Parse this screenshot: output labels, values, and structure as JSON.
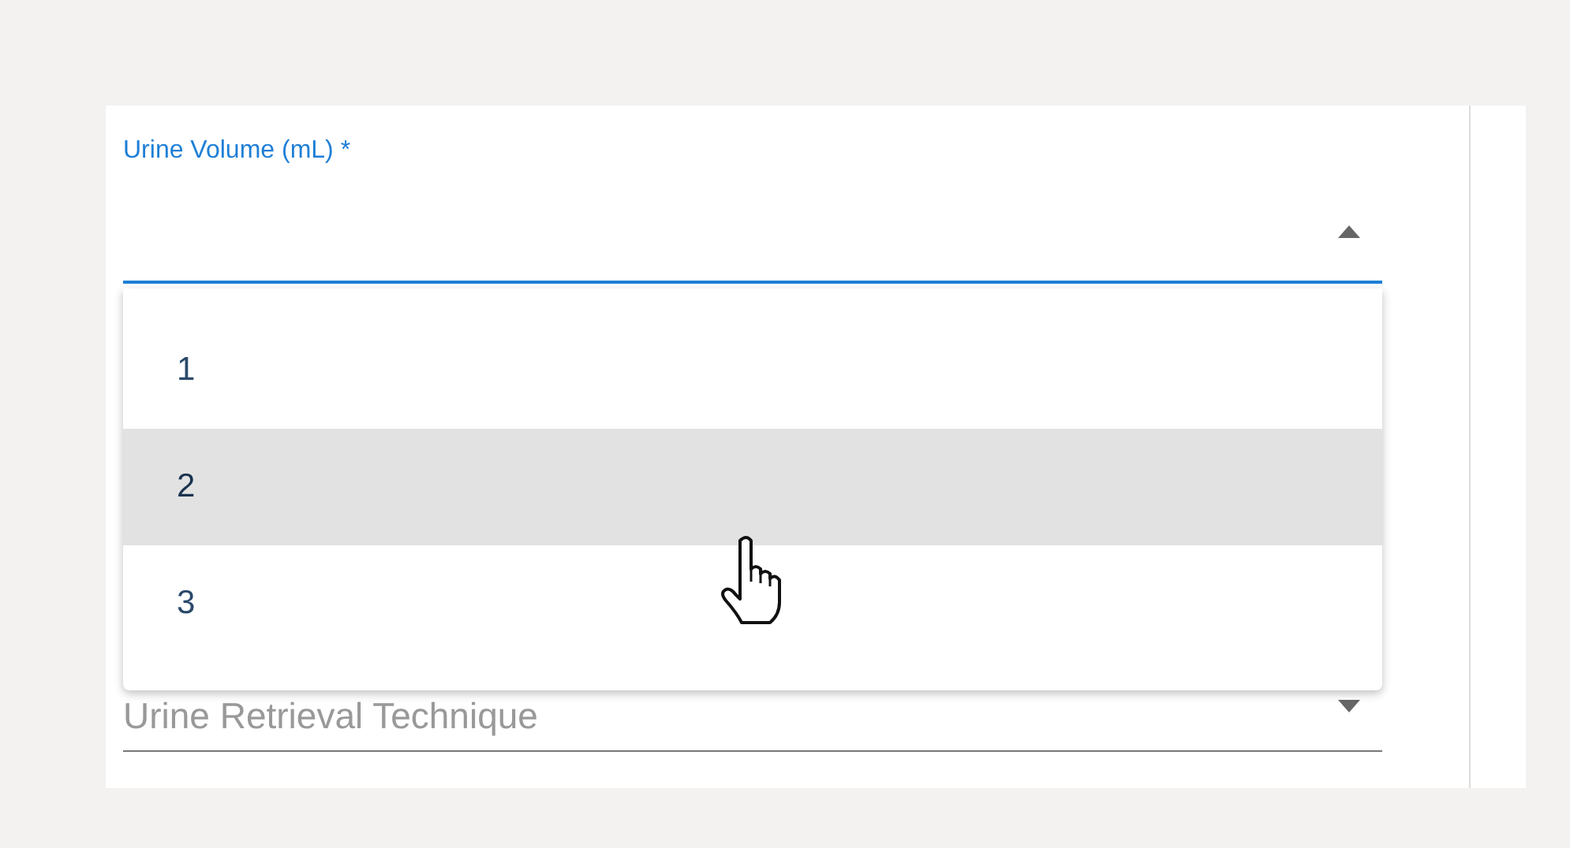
{
  "fields": [
    {
      "label": "Urine Volume (mL) *",
      "focused": true,
      "expanded": true,
      "options": [
        {
          "label": "1",
          "selected": false
        },
        {
          "label": "2",
          "selected": true
        },
        {
          "label": "3",
          "selected": false
        }
      ]
    },
    {
      "placeholder": "Urine Retrieval Technique",
      "focused": false,
      "expanded": false
    }
  ]
}
